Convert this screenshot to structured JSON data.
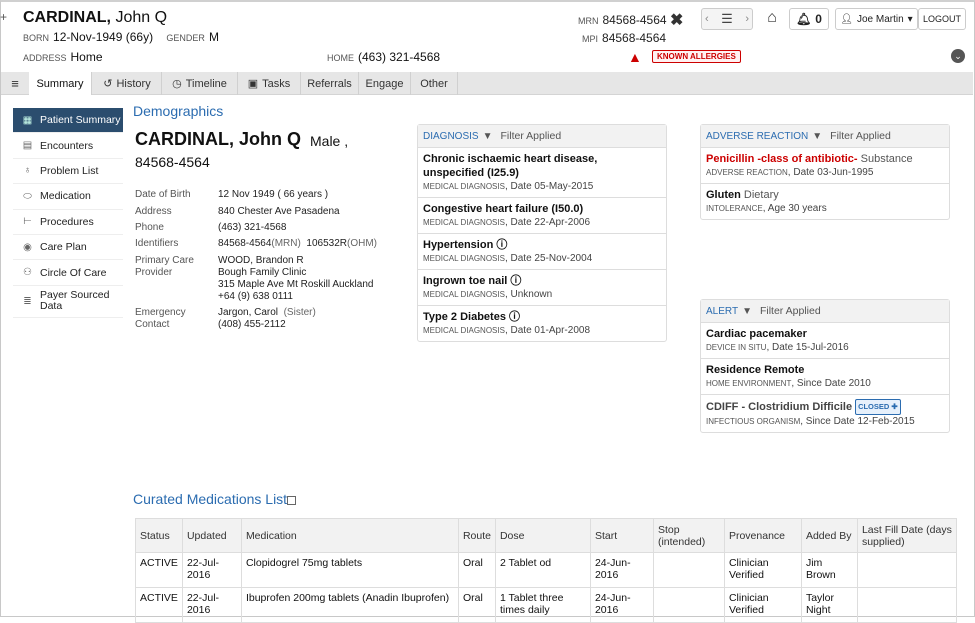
{
  "header": {
    "surname": "CARDINAL,",
    "given": "John Q",
    "born_label": "BORN",
    "born": "12-Nov-1949 (66y)",
    "gender_label": "GENDER",
    "gender": "M",
    "address_label": "ADDRESS",
    "address": "Home",
    "home_label": "HOME",
    "home_phone": "(463) 321-4568",
    "mrn_label": "MRN",
    "mrn": "84568-4564",
    "mpi_label": "MPI",
    "mpi": "84568-4564",
    "allergy_badge": "KNOWN ALLERGIES",
    "notifications": "0",
    "user": "Joe Martin",
    "logout": "LOGOUT"
  },
  "tabs": [
    {
      "label": "Summary",
      "icon": ""
    },
    {
      "label": "History",
      "icon": "history-icon"
    },
    {
      "label": "Timeline",
      "icon": "clock-icon"
    },
    {
      "label": "Tasks",
      "icon": "camera-icon"
    },
    {
      "label": "Referrals",
      "icon": ""
    },
    {
      "label": "Engage",
      "icon": ""
    },
    {
      "label": "Other",
      "icon": ""
    }
  ],
  "sidebar": [
    {
      "label": "Patient Summary",
      "icon": "grid-icon"
    },
    {
      "label": "Encounters",
      "icon": "calendar-icon"
    },
    {
      "label": "Problem List",
      "icon": "stethoscope-icon"
    },
    {
      "label": "Medication",
      "icon": "pill-icon"
    },
    {
      "label": "Procedures",
      "icon": "bed-icon"
    },
    {
      "label": "Care Plan",
      "icon": "target-icon"
    },
    {
      "label": "Circle Of Care",
      "icon": "users-icon"
    },
    {
      "label": "Payer Sourced Data",
      "icon": "database-icon"
    }
  ],
  "demographics": {
    "title": "Demographics",
    "name": "CARDINAL, John Q",
    "sex": "Male ,",
    "mrn": "84568-4564",
    "dob_label": "Date of Birth",
    "dob": "12 Nov 1949 ( 66 years )",
    "address_label": "Address",
    "address": "840 Chester Ave Pasadena",
    "phone_label": "Phone",
    "phone": "(463) 321-4568",
    "identifiers_label": "Identifiers",
    "id1": "84568-4564",
    "id1_type": "(MRN)",
    "id2": "106532R",
    "id2_type": "(OHM)",
    "pcp_label1": "Primary Care",
    "pcp_label2": "Provider",
    "pcp_name": "WOOD, Brandon R",
    "pcp_clinic": "Bough Family Clinic",
    "pcp_address": "315 Maple Ave Mt Roskill Auckland",
    "pcp_phone": "+64 (9) 638 0111",
    "ec_label1": "Emergency",
    "ec_label2": "Contact",
    "ec_name": "Jargon, Carol",
    "ec_rel": "(Sister)",
    "ec_phone": "(408) 455-2112"
  },
  "diagnosis": {
    "title": "DIAGNOSIS",
    "filter": "Filter Applied",
    "items": [
      {
        "title": "Chronic ischaemic heart disease, unspecified (I25.9)",
        "type": "MEDICAL DIAGNOSIS",
        "meta": ", Date 05-May-2015"
      },
      {
        "title": "Congestive heart failure (I50.0)",
        "type": "MEDICAL DIAGNOSIS",
        "meta": ", Date 22-Apr-2006"
      },
      {
        "title": "Hypertension",
        "type": "MEDICAL DIAGNOSIS",
        "meta": ", Date 25-Nov-2004"
      },
      {
        "title": "Ingrown toe nail",
        "type": "MEDICAL DIAGNOSIS",
        "meta": ", Unknown"
      },
      {
        "title": "Type 2 Diabetes",
        "type": "MEDICAL DIAGNOSIS",
        "meta": ", Date 01-Apr-2008"
      }
    ]
  },
  "adverse": {
    "title": "ADVERSE REACTION",
    "filter": "Filter Applied",
    "items": [
      {
        "title": "Penicillin -class of antibiotic-",
        "sub": "Substance",
        "type": "ADVERSE REACTION",
        "meta": ", Date 03-Jun-1995"
      },
      {
        "title": "Gluten",
        "sub": "Dietary",
        "type": "INTOLERANCE",
        "meta": ", Age 30 years"
      }
    ]
  },
  "alert": {
    "title": "ALERT",
    "filter": "Filter Applied",
    "items": [
      {
        "title": "Cardiac pacemaker",
        "type": "DEVICE IN SITU",
        "meta": ", Date 15-Jul-2016"
      },
      {
        "title": "Residence Remote",
        "type": "HOME ENVIRONMENT",
        "meta": ", Since Date 2010"
      },
      {
        "title": "CDIFF - Clostridium Difficile",
        "badge": "CLOSED",
        "type": "INFECTIOUS ORGANISM",
        "meta": ", Since Date 12-Feb-2015"
      }
    ]
  },
  "meds": {
    "title": "Curated Medications List",
    "headers": [
      "Status",
      "Updated",
      "Medication",
      "Route",
      "Dose",
      "Start",
      "Stop (intended)",
      "Provenance",
      "Added By",
      "Last Fill Date (days supplied)"
    ],
    "rows": [
      [
        "ACTIVE",
        "22-Jul-2016",
        "Clopidogrel 75mg tablets",
        "Oral",
        "2 Tablet od",
        "24-Jun-2016",
        "",
        "Clinician Verified",
        "Jim Brown",
        ""
      ],
      [
        "ACTIVE",
        "22-Jul-2016",
        "Ibuprofen 200mg tablets (Anadin Ibuprofen)",
        "Oral",
        "1 Tablet three times daily",
        "24-Jun-2016",
        "",
        "Clinician Verified",
        "Taylor Night",
        ""
      ]
    ]
  }
}
